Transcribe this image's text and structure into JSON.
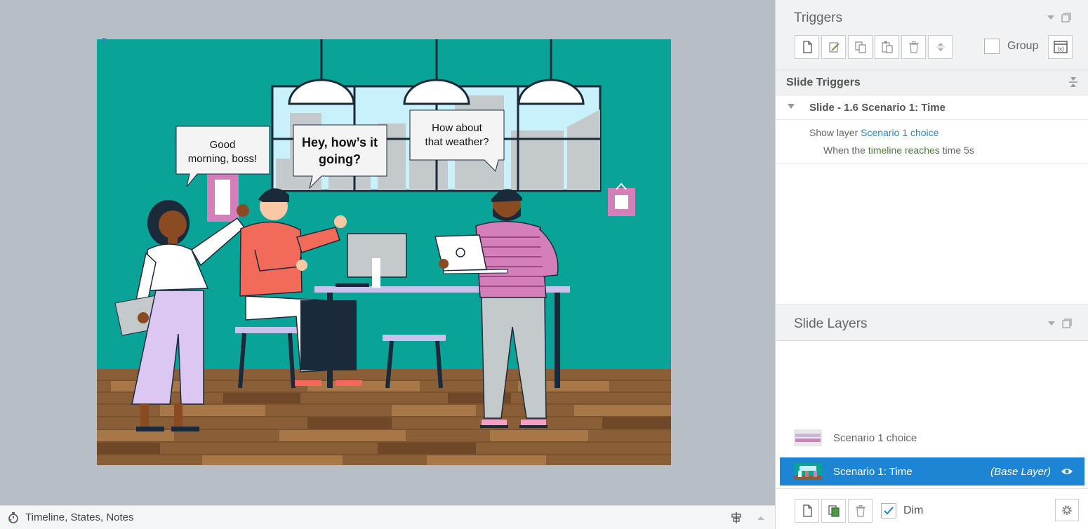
{
  "slide": {
    "bubbles": {
      "left": [
        "Good",
        "morning, boss!"
      ],
      "middle": [
        "Hey, how’s it",
        "going?"
      ],
      "right": [
        "How about",
        "that weather?"
      ]
    }
  },
  "bottombar": {
    "label": "Timeline, States, Notes"
  },
  "triggers_panel": {
    "title": "Triggers",
    "group_label": "Group",
    "section_label": "Slide Triggers",
    "trigger_group_label": "Slide - 1.6 Scenario 1: Time",
    "trigger": {
      "action": "Show layer",
      "target": "Scenario 1 choice",
      "condition_prefix": "When the",
      "condition_object": "timeline",
      "condition_event": "reaches",
      "condition_suffix": "time 5s"
    }
  },
  "layers_panel": {
    "title": "Slide Layers",
    "layers": [
      {
        "name": "Scenario 1 choice"
      },
      {
        "name": "Scenario 1: Time",
        "tag": "(Base Layer)"
      }
    ],
    "dim_label": "Dim",
    "dim_checked": true
  },
  "colors": {
    "accent_blue": "#1e84d4",
    "wall_teal": "#0aa397",
    "link_blue": "#2f84b8",
    "link_green": "#4f7b3a"
  }
}
